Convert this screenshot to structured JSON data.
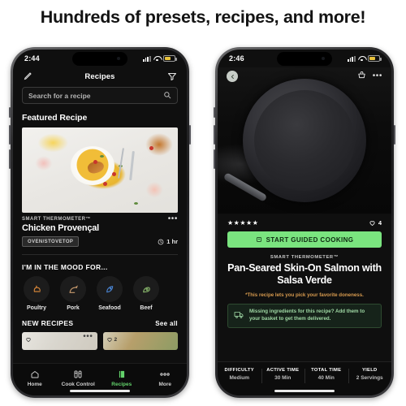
{
  "headline": "Hundreds of presets, recipes, and more!",
  "left_phone": {
    "status": {
      "time": "2:44"
    },
    "appbar": {
      "title": "Recipes",
      "edit_icon": "pencil-icon",
      "filter_icon": "filter-funnel-icon"
    },
    "search": {
      "placeholder": "Search for a recipe",
      "icon": "search-icon"
    },
    "featured": {
      "section_title": "Featured Recipe",
      "brand": "SMART THERMOMETER™",
      "name": "Chicken Provençal",
      "badge": "OVEN/STOVETOP",
      "time": "1 hr",
      "more_icon": "more-dots-icon",
      "clock_icon": "clock-icon"
    },
    "mood": {
      "title": "I'M IN THE MOOD FOR...",
      "items": [
        {
          "label": "Poultry",
          "icon": "poultry-icon",
          "color": "#e08b3a"
        },
        {
          "label": "Pork",
          "icon": "pork-icon",
          "color": "#c79a6d"
        },
        {
          "label": "Seafood",
          "icon": "seafood-icon",
          "color": "#4a86d6"
        },
        {
          "label": "Beef",
          "icon": "beef-icon",
          "color": "#86b36a"
        }
      ]
    },
    "new_recipes": {
      "title": "NEW RECIPES",
      "see_all": "See all",
      "cards": [
        {
          "likes": "",
          "heart_icon": "heart-icon",
          "more_icon": "more-dots-icon"
        },
        {
          "likes": "2",
          "heart_icon": "heart-icon",
          "more_icon": "more-dots-icon"
        }
      ]
    },
    "tabs": [
      {
        "label": "Home",
        "icon": "home-icon",
        "active": false
      },
      {
        "label": "Cook Control",
        "icon": "cook-control-icon",
        "active": false
      },
      {
        "label": "Recipes",
        "icon": "recipes-book-icon",
        "active": true
      },
      {
        "label": "More",
        "icon": "more-dots-icon",
        "active": false
      }
    ]
  },
  "right_phone": {
    "status": {
      "time": "2:46"
    },
    "topbar": {
      "back_icon": "back-chevron-icon",
      "basket_icon": "basket-icon",
      "more_icon": "more-dots-icon"
    },
    "rating": {
      "stars": "★★★★★",
      "likes": "4",
      "heart_icon": "heart-icon"
    },
    "cta": {
      "label": "START GUIDED COOKING",
      "icon": "thermometer-icon",
      "color": "#7ae47f"
    },
    "recipe": {
      "brand": "SMART THERMOMETER™",
      "title": "Pan-Seared Skin-On Salmon with Salsa Verde",
      "note": "*This recipe lets you pick your favorite doneness.",
      "note_color": "#d79a4e"
    },
    "notice": {
      "icon": "delivery-truck-icon",
      "text": "Missing ingredients for this recipe? Add them to your basket to get them delivered."
    },
    "info": [
      {
        "key": "DIFFICULTY",
        "value": "Medium"
      },
      {
        "key": "ACTIVE TIME",
        "value": "30 Min"
      },
      {
        "key": "TOTAL TIME",
        "value": "40 Min"
      },
      {
        "key": "YIELD",
        "value": "2 Servings"
      }
    ]
  }
}
